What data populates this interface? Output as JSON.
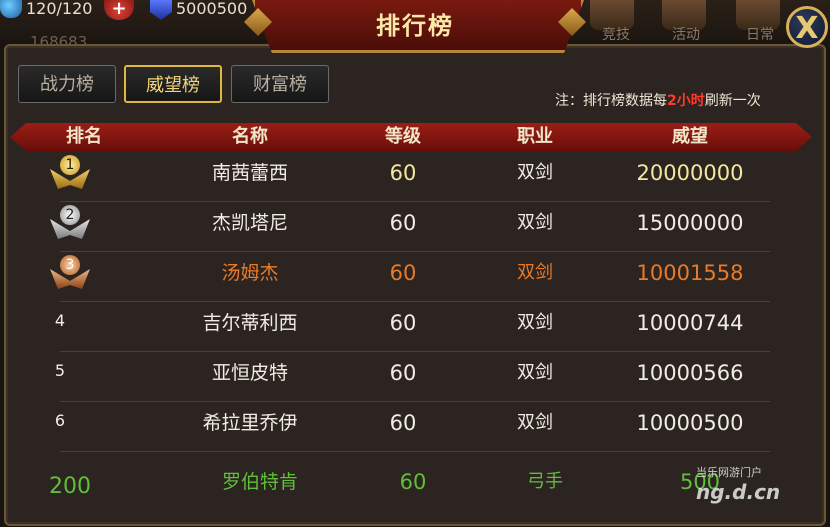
{
  "hud": {
    "energy": "120/120",
    "plus": "+",
    "gold": "5000500",
    "power": "168683",
    "right_labels": [
      "竞技",
      "活动",
      "日常"
    ]
  },
  "panel": {
    "title": "排行榜",
    "close": "X"
  },
  "tabs": [
    {
      "label": "战力榜",
      "active": false
    },
    {
      "label": "威望榜",
      "active": true
    },
    {
      "label": "财富榜",
      "active": false
    }
  ],
  "note": {
    "prefix": "注：排行榜数据每",
    "highlight": "2小时",
    "suffix": "刷新一次"
  },
  "columns": [
    "排名",
    "名称",
    "等级",
    "职业",
    "威望"
  ],
  "rows": [
    {
      "rank": "1",
      "name": "南茜蕾西",
      "level": "60",
      "job": "双剑",
      "prestige": "20000000",
      "medal": "gold"
    },
    {
      "rank": "2",
      "name": "杰凯塔尼",
      "level": "60",
      "job": "双剑",
      "prestige": "15000000",
      "medal": "silver"
    },
    {
      "rank": "3",
      "name": "汤姆杰",
      "level": "60",
      "job": "双剑",
      "prestige": "10001558",
      "medal": "bronze"
    },
    {
      "rank": "4",
      "name": "吉尔蒂利西",
      "level": "60",
      "job": "双剑",
      "prestige": "10000744"
    },
    {
      "rank": "5",
      "name": "亚恒皮特",
      "level": "60",
      "job": "双剑",
      "prestige": "10000566"
    },
    {
      "rank": "6",
      "name": "希拉里乔伊",
      "level": "60",
      "job": "双剑",
      "prestige": "10000500"
    }
  ],
  "self": {
    "rank": "200",
    "name": "罗伯特肯",
    "level": "60",
    "job": "弓手",
    "prestige": "500"
  },
  "watermark": {
    "small": "当乐网游门户",
    "big": "ng.d.cn"
  },
  "colors": {
    "accent": "#e0b840",
    "ribbon": "#9a1e16",
    "self_green": "#5fbf3a",
    "third_orange": "#e87a2a"
  }
}
